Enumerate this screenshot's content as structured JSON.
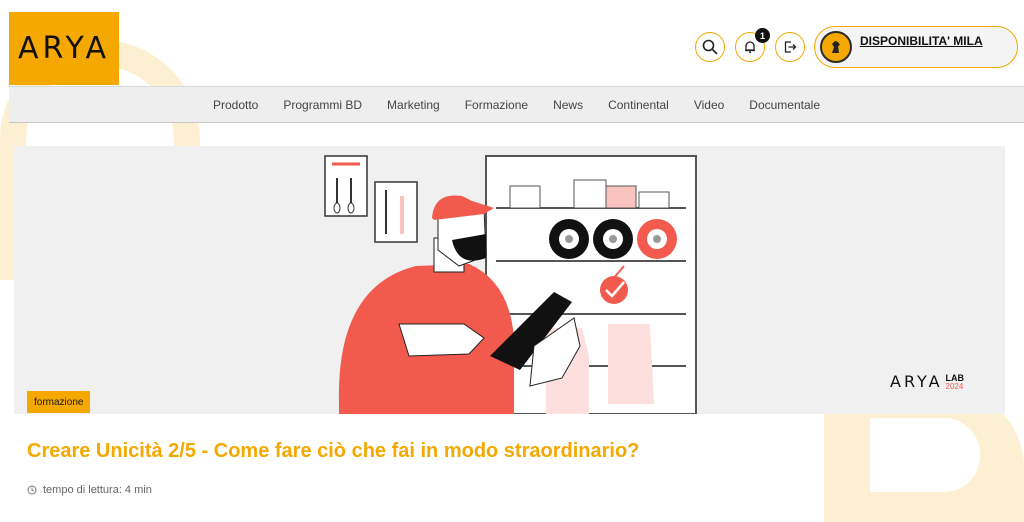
{
  "header": {
    "logo_text": "ARYA",
    "notifications_count": "1",
    "dealer_name": "DISPONIBILITA' MILA"
  },
  "nav": {
    "items": [
      "Prodotto",
      "Programmi BD",
      "Marketing",
      "Formazione",
      "News",
      "Continental",
      "Video",
      "Documentale"
    ]
  },
  "hero": {
    "brand_logo": "ARYA",
    "brand_lab": "LAB",
    "brand_year": "2024"
  },
  "article": {
    "category": "formazione",
    "title": "Creare Unicità 2/5 - Come fare ciò che fai in modo straordinario?",
    "reading_time": "tempo di lettura: 4 min"
  },
  "colors": {
    "accent": "#f5a800",
    "illustration_red": "#f25a4e"
  },
  "icons": {
    "search": "search-icon",
    "notifications": "bell-icon",
    "logout": "logout-icon",
    "clock": "clock-icon"
  }
}
